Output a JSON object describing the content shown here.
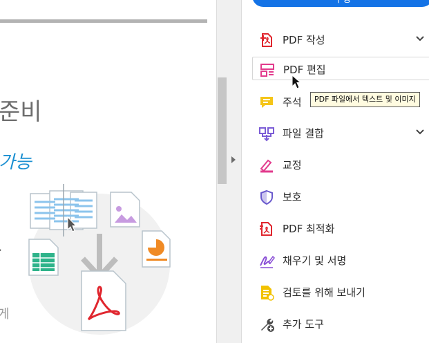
{
  "document": {
    "heading": "준비",
    "subheading": "가능",
    "fragment_1": "·",
    "fragment_2": "게"
  },
  "tools_panel": {
    "primary_button_label": "수정",
    "items": [
      {
        "label": "PDF 작성",
        "icon": "pdf-create-icon",
        "expandable": true
      },
      {
        "label": "PDF 편집",
        "icon": "pdf-edit-icon",
        "expandable": false
      },
      {
        "label": "주석",
        "icon": "comment-icon",
        "expandable": false
      },
      {
        "label": "파일 결합",
        "icon": "combine-files-icon",
        "expandable": true
      },
      {
        "label": "교정",
        "icon": "redact-icon",
        "expandable": false
      },
      {
        "label": "보호",
        "icon": "shield-icon",
        "expandable": false
      },
      {
        "label": "PDF 최적화",
        "icon": "optimize-pdf-icon",
        "expandable": false
      },
      {
        "label": "채우기 및 서명",
        "icon": "fill-sign-icon",
        "expandable": false
      },
      {
        "label": "검토를 위해 보내기",
        "icon": "send-review-icon",
        "expandable": false
      },
      {
        "label": "추가 도구",
        "icon": "more-tools-icon",
        "expandable": false
      }
    ]
  },
  "tooltip": {
    "text": "PDF 파일에서 텍스트 및 이미지"
  },
  "colors": {
    "accent_blue": "#1473e6",
    "pdf_red": "#e0262e",
    "comment_yellow": "#f5c518",
    "combine_purple": "#7b5cd6",
    "redact_pink": "#e23a8c",
    "protect_purple": "#6a5acd",
    "review_yellow": "#f2c200",
    "tool_grey": "#4b4b4b"
  }
}
